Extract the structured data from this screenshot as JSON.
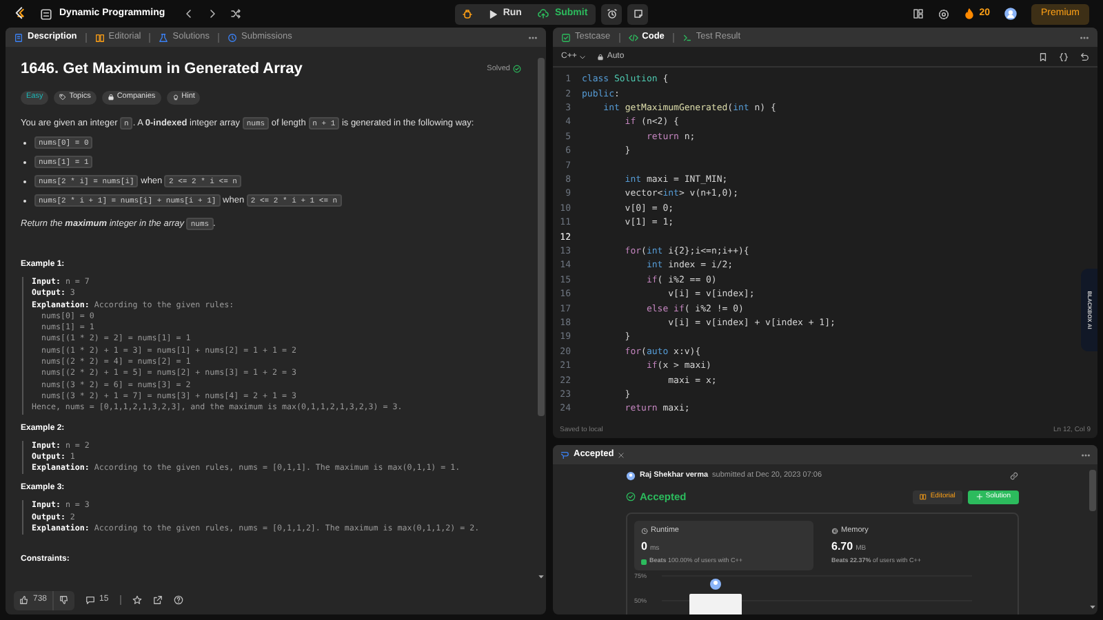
{
  "top_bar": {
    "title": "Dynamic Programming",
    "run": "Run",
    "submit": "Submit",
    "streak": "20",
    "premium": "Premium"
  },
  "description_panel": {
    "tabs": [
      {
        "label": "Description",
        "selected": true
      },
      {
        "label": "Editorial",
        "selected": false
      },
      {
        "label": "Solutions",
        "selected": false
      },
      {
        "label": "Submissions",
        "selected": false
      }
    ],
    "title": "1646. Get Maximum in Generated Array",
    "status": "Solved",
    "tags": [
      {
        "kind": "difficulty",
        "label": "Easy"
      },
      {
        "kind": "topics",
        "label": "Topics"
      },
      {
        "kind": "companies",
        "label": "Companies"
      },
      {
        "kind": "hint",
        "label": "Hint"
      }
    ],
    "intro": [
      {
        "kind": "text",
        "text": "You are given an integer "
      },
      {
        "kind": "code",
        "text": "n"
      },
      {
        "kind": "text",
        "text": ". A **0-indexed** integer array "
      },
      {
        "kind": "code",
        "text": "nums"
      },
      {
        "kind": "text",
        "text": " of length "
      },
      {
        "kind": "code",
        "text": "n + 1"
      },
      {
        "kind": "text",
        "text": " is generated in the following way:"
      }
    ],
    "rules": [
      [
        {
          "kind": "code",
          "text": "nums[0] = 0"
        }
      ],
      [
        {
          "kind": "code",
          "text": "nums[1] = 1"
        }
      ],
      [
        {
          "kind": "code",
          "text": "nums[2 * i] = nums[i]"
        },
        {
          "kind": "text",
          "text": " when "
        },
        {
          "kind": "code",
          "text": "2 <= 2 * i <= n"
        }
      ],
      [
        {
          "kind": "code",
          "text": "nums[2 * i + 1] = nums[i] + nums[i + 1]"
        },
        {
          "kind": "text",
          "text": " when "
        },
        {
          "kind": "code",
          "text": "2 <= 2 * i + 1 <= n"
        }
      ]
    ],
    "closing": [
      {
        "kind": "emphasis",
        "text": "Return the **maximum** integer in the array "
      },
      {
        "kind": "code",
        "text": "nums"
      },
      {
        "kind": "text",
        "text": "."
      }
    ],
    "examples": [
      {
        "title": "Example 1:",
        "input_label": "Input:",
        "input": "n = 7",
        "output_label": "Output:",
        "output": "3",
        "explanation_label": "Explanation:",
        "explanation": "According to the given rules:",
        "steps": [
          "nums[0] = 0",
          "nums[1] = 1",
          "nums[(1 * 2) = 2] = nums[1] = 1",
          "nums[(1 * 2) + 1 = 3] = nums[1] + nums[2] = 1 + 1 = 2",
          "nums[(2 * 2) = 4] = nums[2] = 1",
          "nums[(2 * 2) + 1 = 5] = nums[2] + nums[3] = 1 + 2 = 3",
          "nums[(3 * 2) = 6] = nums[3] = 2",
          "nums[(3 * 2) + 1 = 7] = nums[3] + nums[4] = 2 + 1 = 3"
        ],
        "conclusion": "Hence, nums = [0,1,1,2,1,3,2,3], and the maximum is max(0,1,1,2,1,3,2,3) = 3."
      },
      {
        "title": "Example 2:",
        "input_label": "Input:",
        "input": "n = 2",
        "output_label": "Output:",
        "output": "1",
        "explanation_label": "Explanation:",
        "explanation": "According to the given rules, nums = [0,1,1]. The maximum is max(0,1,1) = 1."
      },
      {
        "title": "Example 3:",
        "input_label": "Input:",
        "input": "n = 3",
        "output_label": "Output:",
        "output": "2",
        "explanation_label": "Explanation:",
        "explanation": "According to the given rules, nums = [0,1,1,2]. The maximum is max(0,1,1,2) = 2."
      }
    ],
    "constraints_title": "Constraints:",
    "likes": "738",
    "comments": "15"
  },
  "editor": {
    "tabs": [
      {
        "label": "Testcase",
        "selected": false
      },
      {
        "label": "Code",
        "selected": true
      },
      {
        "label": "Test Result",
        "selected": false
      }
    ],
    "language": "C++",
    "mode": "Auto",
    "lines": [
      {
        "number": "1",
        "current": false,
        "tokens": [
          {
            "kind": "keyword",
            "text": "class "
          },
          {
            "kind": "type",
            "text": "Solution"
          },
          {
            "kind": "text",
            "text": " {"
          }
        ]
      },
      {
        "number": "2",
        "current": false,
        "tokens": [
          {
            "kind": "keyword",
            "text": "public"
          },
          {
            "kind": "text",
            "text": ":"
          }
        ]
      },
      {
        "number": "3",
        "current": false,
        "tokens": [
          {
            "kind": "keyword",
            "text": "    int "
          },
          {
            "kind": "function",
            "text": "getMaximumGenerated"
          },
          {
            "kind": "text",
            "text": "("
          },
          {
            "kind": "keyword",
            "text": "int"
          },
          {
            "kind": "text",
            "text": " n) {"
          }
        ]
      },
      {
        "number": "4",
        "current": false,
        "tokens": [
          {
            "kind": "control",
            "text": "        if"
          },
          {
            "kind": "text",
            "text": " (n<2) {"
          }
        ]
      },
      {
        "number": "5",
        "current": false,
        "tokens": [
          {
            "kind": "control",
            "text": "            return"
          },
          {
            "kind": "text",
            "text": " n;"
          }
        ]
      },
      {
        "number": "6",
        "current": false,
        "tokens": [
          {
            "kind": "text",
            "text": "        }"
          }
        ]
      },
      {
        "number": "7",
        "current": false
      },
      {
        "number": "8",
        "current": false,
        "tokens": [
          {
            "kind": "keyword",
            "text": "        int"
          },
          {
            "kind": "text",
            "text": " maxi = INT_MIN;"
          }
        ]
      },
      {
        "number": "9",
        "current": false,
        "tokens": [
          {
            "kind": "text",
            "text": "        vector<"
          },
          {
            "kind": "keyword",
            "text": "int"
          },
          {
            "kind": "text",
            "text": "> v(n+1,0);"
          }
        ]
      },
      {
        "number": "10",
        "current": false,
        "tokens": [
          {
            "kind": "text",
            "text": "        v[0] = 0;"
          }
        ]
      },
      {
        "number": "11",
        "current": false,
        "tokens": [
          {
            "kind": "text",
            "text": "        v[1] = 1;"
          }
        ]
      },
      {
        "number": "12",
        "current": true
      },
      {
        "number": "13",
        "current": false,
        "tokens": [
          {
            "kind": "control",
            "text": "        for"
          },
          {
            "kind": "text",
            "text": "("
          },
          {
            "kind": "keyword",
            "text": "int"
          },
          {
            "kind": "text",
            "text": " i{2};i<=n;i++){"
          }
        ]
      },
      {
        "number": "14",
        "current": false,
        "tokens": [
          {
            "kind": "keyword",
            "text": "            int"
          },
          {
            "kind": "text",
            "text": " index = i/2;"
          }
        ]
      },
      {
        "number": "15",
        "current": false,
        "tokens": [
          {
            "kind": "control",
            "text": "            if"
          },
          {
            "kind": "text",
            "text": "( i%2 == 0)"
          }
        ]
      },
      {
        "number": "16",
        "current": false,
        "tokens": [
          {
            "kind": "text",
            "text": "                v[i] = v[index];"
          }
        ]
      },
      {
        "number": "17",
        "current": false,
        "tokens": [
          {
            "kind": "control",
            "text": "            else if"
          },
          {
            "kind": "text",
            "text": "( i%2 != 0)"
          }
        ]
      },
      {
        "number": "18",
        "current": false,
        "tokens": [
          {
            "kind": "text",
            "text": "                v[i] = v[index] + v[index + 1];"
          }
        ]
      },
      {
        "number": "19",
        "current": false,
        "tokens": [
          {
            "kind": "text",
            "text": "        }"
          }
        ]
      },
      {
        "number": "20",
        "current": false,
        "tokens": [
          {
            "kind": "control",
            "text": "        for"
          },
          {
            "kind": "text",
            "text": "("
          },
          {
            "kind": "keyword",
            "text": "auto"
          },
          {
            "kind": "text",
            "text": " x:v){"
          }
        ]
      },
      {
        "number": "21",
        "current": false,
        "tokens": [
          {
            "kind": "control",
            "text": "            if"
          },
          {
            "kind": "text",
            "text": "(x > maxi)"
          }
        ]
      },
      {
        "number": "22",
        "current": false,
        "tokens": [
          {
            "kind": "text",
            "text": "                maxi = x;"
          }
        ]
      },
      {
        "number": "23",
        "current": false,
        "tokens": [
          {
            "kind": "text",
            "text": "        }"
          }
        ]
      },
      {
        "number": "24",
        "current": false,
        "tokens": [
          {
            "kind": "control",
            "text": "        return"
          },
          {
            "kind": "text",
            "text": " maxi;"
          }
        ]
      }
    ],
    "saved": "Saved to local",
    "cursor": "Ln 12, Col 9",
    "assistant_tab": "BLACKBOX AI"
  },
  "result": {
    "tab": "Accepted",
    "author": "Raj Shekhar verma",
    "submitted": "submitted at Dec 20, 2023 07:06",
    "verdict": "Accepted",
    "editorial": "Editorial",
    "solution": "Solution",
    "stats": [
      {
        "kind": "runtime",
        "label": "Runtime",
        "value": "0",
        "unit": "ms",
        "beats": "**Beats** 100.00% of users with C++",
        "selected": true
      },
      {
        "kind": "memory",
        "label": "Memory",
        "value": "6.70",
        "unit": "MB",
        "beats": "**Beats 22.37%** of users with C++",
        "selected": false
      }
    ],
    "distribution_chart": {
      "tick_labels": [
        "75%",
        "50%"
      ]
    }
  }
}
